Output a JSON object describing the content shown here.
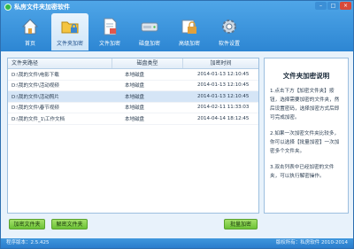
{
  "app": {
    "title": "私房文件夹加密软件"
  },
  "window_controls": {
    "minimize": "–",
    "maximize": "□",
    "close": "×"
  },
  "nav": [
    {
      "label": "首页",
      "icon": "home-icon"
    },
    {
      "label": "文件夹加密",
      "icon": "folder-lock-icon"
    },
    {
      "label": "文件加密",
      "icon": "file-lock-icon"
    },
    {
      "label": "磁盘加密",
      "icon": "disk-icon"
    },
    {
      "label": "高级加密",
      "icon": "advanced-encrypt-icon"
    },
    {
      "label": "软件设置",
      "icon": "gear-icon"
    }
  ],
  "table": {
    "headers": [
      "文件夹路径",
      "磁盘类型",
      "加密时间"
    ],
    "rows": [
      {
        "path": "D:\\我的文件\\电影下载",
        "type": "本地磁盘",
        "time": "2014-01-13 12:10:45"
      },
      {
        "path": "D:\\我的文件\\活动视频",
        "type": "本地磁盘",
        "time": "2014-01-13 12:10:45"
      },
      {
        "path": "D:\\我的文件\\活动照片",
        "type": "本地磁盘",
        "time": "2014-01-13 12:10:45"
      },
      {
        "path": "D:\\我的文件\\春节视频",
        "type": "本地磁盘",
        "time": "2014-02-11 11:33:03"
      },
      {
        "path": "D:\\我的文件_1\\工作文档",
        "type": "本地磁盘",
        "time": "2014-04-14 18:12:45"
      }
    ]
  },
  "side": {
    "title": "文件夹加密说明",
    "items": [
      "1.点击下方【加密文件夹】按钮，选择需要加密的文件夹，然后设置密码，选择加密方式后即可完成加密。",
      "2.如果一次加密文件夹比较多，你可以选择【批量加密】一次加密多个文件夹。",
      "3.双击列表中已经加密的文件夹，可以执行解密操作。"
    ]
  },
  "buttons": {
    "encrypt": "加密文件夹",
    "decrypt": "解密文件夹",
    "batch": "批量加密"
  },
  "status": {
    "version": "程序版本：2.5.425",
    "copyright": "版权所有：私房软件  2010-2014"
  },
  "colors": {
    "header_top": "#4fa6e8",
    "header_bottom": "#2d86d3",
    "button": "#6cc236",
    "accent": "#1e4f8a"
  }
}
